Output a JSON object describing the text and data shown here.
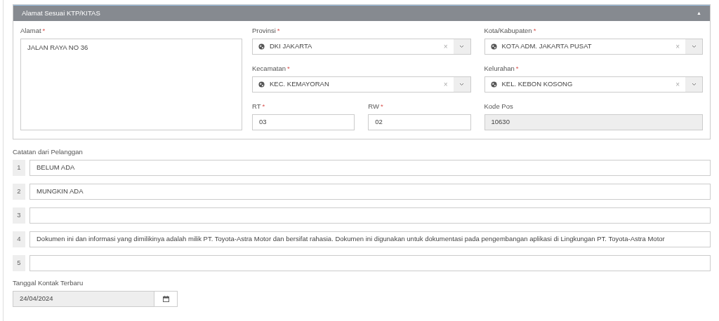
{
  "panel": {
    "title": "Alamat Sesuai KTP/KITAS",
    "toggle": "▲",
    "address": {
      "label": "Alamat",
      "required_mark": "*",
      "value": "JALAN RAYA NO 36"
    },
    "fields": [
      {
        "kind": "select",
        "label": "Provinsi",
        "required_mark": "*",
        "value": "DKI JAKARTA",
        "clear": "×"
      },
      {
        "kind": "select",
        "label": "Kota/Kabupaten",
        "required_mark": "*",
        "value": "KOTA ADM. JAKARTA PUSAT",
        "clear": "×"
      },
      {
        "kind": "select",
        "label": "Kecamatan",
        "required_mark": "*",
        "value": "KEC. KEMAYORAN",
        "clear": "×"
      },
      {
        "kind": "select",
        "label": "Kelurahan",
        "required_mark": "*",
        "value": "KEL. KEBON KOSONG",
        "clear": "×"
      },
      {
        "kind": "text",
        "label": "RT",
        "required_mark": "*",
        "value": "03",
        "disabled": false
      },
      {
        "kind": "text",
        "label": "RW",
        "required_mark": "*",
        "value": "02",
        "disabled": false
      },
      {
        "kind": "text",
        "label": "Kode Pos",
        "value": "10630",
        "disabled": true
      }
    ]
  },
  "notes": {
    "label": "Catatan dari Pelanggan",
    "items": [
      {
        "number": "1",
        "value": "BELUM ADA"
      },
      {
        "number": "2",
        "value": "MUNGKIN ADA"
      },
      {
        "number": "3"
      },
      {
        "number": "4",
        "value": "Dokumen ini dan informasi yang dimilikinya adalah milik PT. Toyota-Astra Motor dan bersifat rahasia. Dokumen ini digunakan untuk dokumentasi pada pengembangan aplikasi di Lingkungan PT. Toyota-Astra Motor"
      },
      {
        "number": "5"
      }
    ]
  },
  "last_contact": {
    "label": "Tanggal Kontak Terbaru",
    "value": "24/04/2024",
    "disabled": true
  }
}
